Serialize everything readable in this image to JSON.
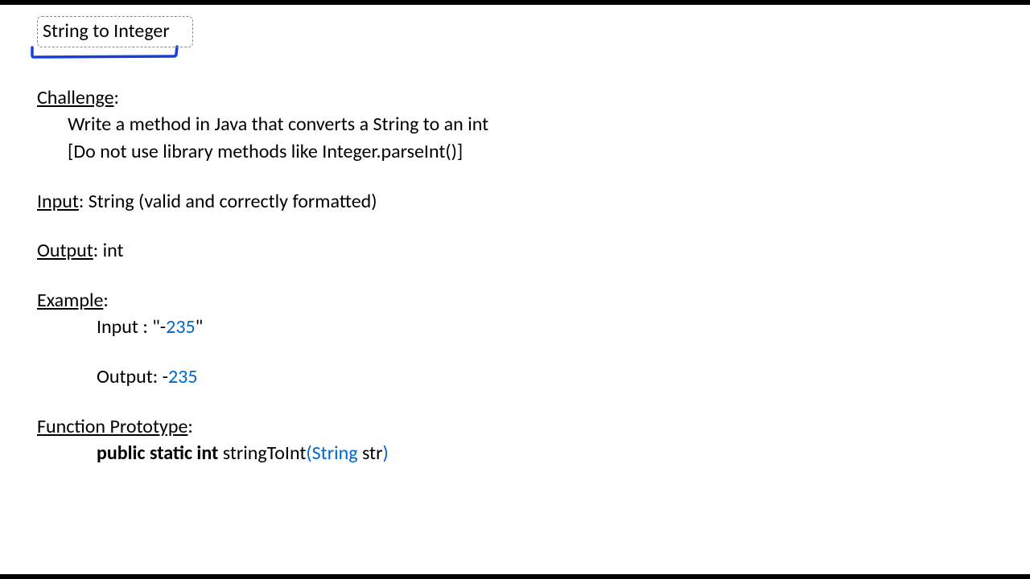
{
  "title": "String to Integer",
  "challenge": {
    "heading": "Challenge",
    "line1": "Write a method in Java that converts a String to an int",
    "line2": "[Do not use library methods like Integer.parseInt()]"
  },
  "input": {
    "label": "Input",
    "text": ": String (valid and correctly formatted)"
  },
  "output": {
    "label": "Output",
    "text": ": int"
  },
  "example": {
    "heading": "Example",
    "input_label": "Input : \"-",
    "input_num": "235",
    "input_close": "\"",
    "output_label": "Output: -",
    "output_num": "235"
  },
  "prototype": {
    "heading": "Function Prototype",
    "kw1": "public static int",
    "fn": " stringToInt",
    "paren_open": "(",
    "type": "String",
    "param": " str",
    "paren_close": ")"
  }
}
